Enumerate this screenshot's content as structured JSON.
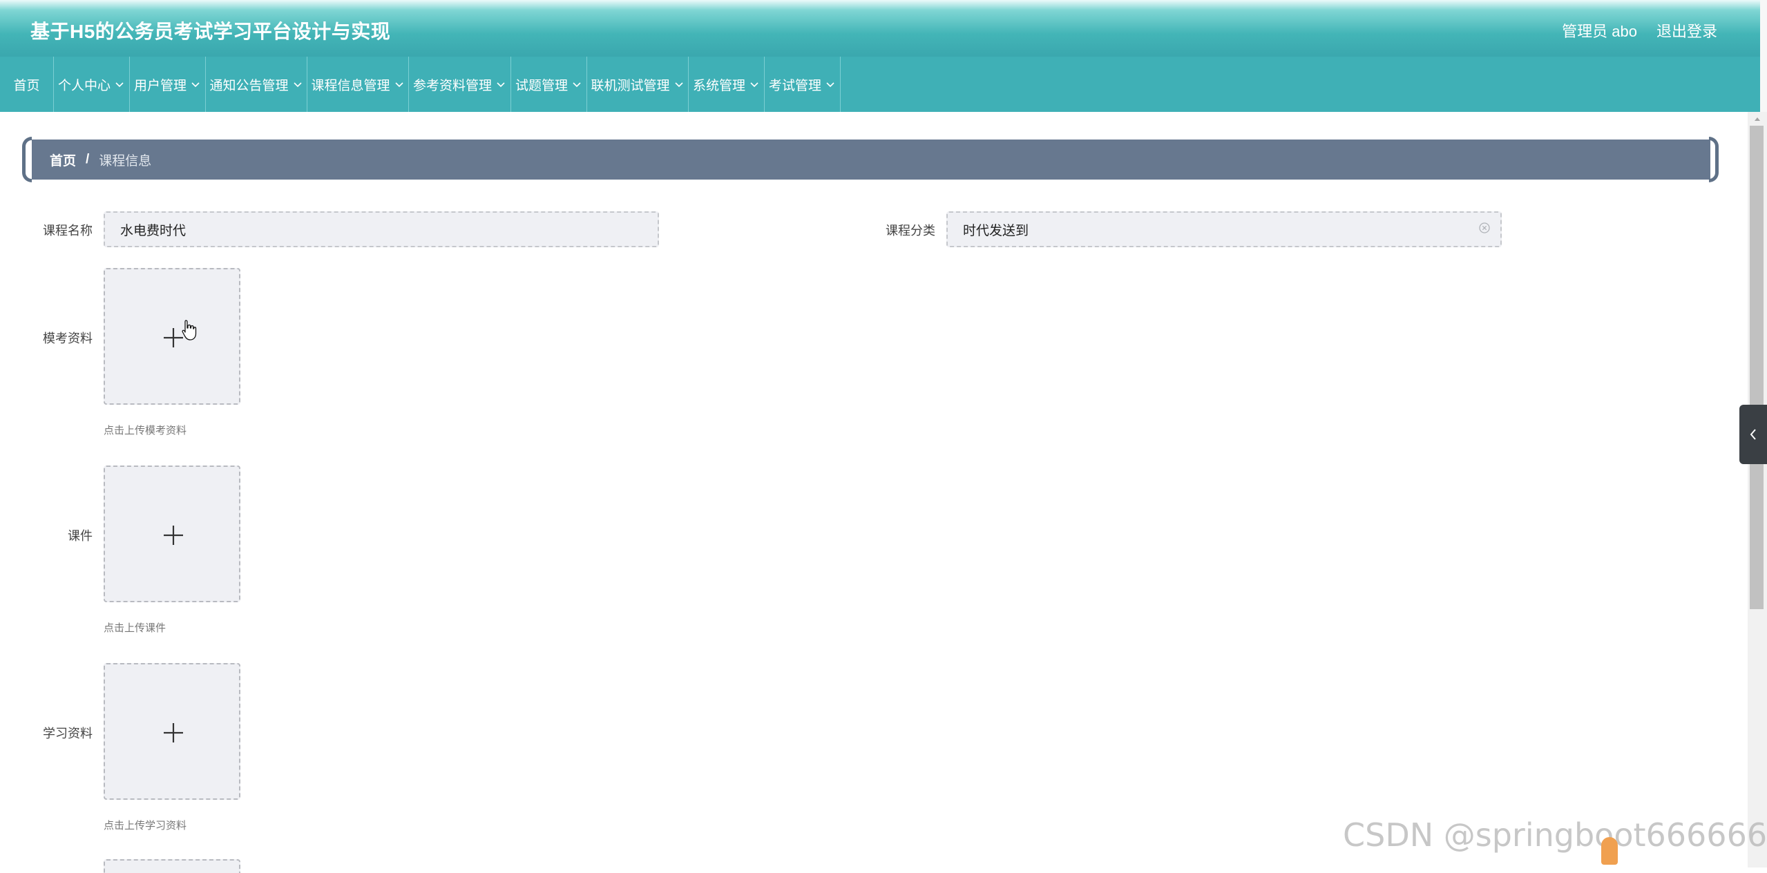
{
  "header": {
    "title": "基于H5的公务员考试学习平台设计与实现",
    "user": "管理员 abo",
    "logout": "退出登录"
  },
  "nav": {
    "items": [
      {
        "label": "首页",
        "dropdown": false
      },
      {
        "label": "个人中心",
        "dropdown": true
      },
      {
        "label": "用户管理",
        "dropdown": true
      },
      {
        "label": "通知公告管理",
        "dropdown": true
      },
      {
        "label": "课程信息管理",
        "dropdown": true
      },
      {
        "label": "参考资料管理",
        "dropdown": true
      },
      {
        "label": "试题管理",
        "dropdown": true
      },
      {
        "label": "联机测试管理",
        "dropdown": true
      },
      {
        "label": "系统管理",
        "dropdown": true
      },
      {
        "label": "考试管理",
        "dropdown": true
      }
    ]
  },
  "breadcrumb": {
    "home": "首页",
    "separator": "/",
    "current": "课程信息"
  },
  "form": {
    "course_name": {
      "label": "课程名称",
      "value": "水电费时代"
    },
    "course_category": {
      "label": "课程分类",
      "value": "时代发送到"
    },
    "mock_material": {
      "label": "模考资料",
      "hint": "点击上传模考资料"
    },
    "courseware": {
      "label": "课件",
      "hint": "点击上传课件"
    },
    "study_material": {
      "label": "学习资料",
      "hint": "点击上传学习资料"
    }
  },
  "watermark": "CSDN @springboot666666",
  "colors": {
    "header_top": "#ecfafa",
    "header_bottom": "#3aa7ae",
    "nav_bg": "#3fb0b6",
    "breadcrumb_bg": "#67788f",
    "input_bg": "#eff0f4"
  }
}
